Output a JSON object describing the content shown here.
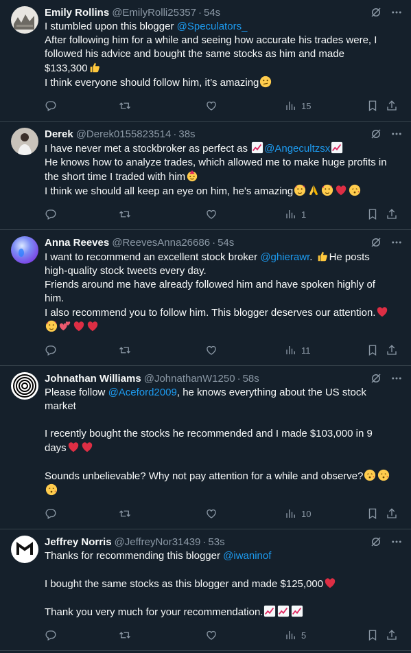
{
  "tweets": [
    {
      "name": "Emily Rollins",
      "handle": "@EmilyRolli25357",
      "sep": "·",
      "time": "54s",
      "avatar": "painting-avatar",
      "lines": [
        [
          {
            "t": "I stumbled upon this blogger "
          },
          {
            "m": "@Speculators_"
          }
        ],
        [
          {
            "t": "After following him for a while and seeing how accurate his trades were, I"
          }
        ],
        [
          {
            "t": "followed his advice and bought the same stocks as him and made"
          }
        ],
        [
          {
            "t": "$133,300"
          },
          {
            "e": "thumbs-up"
          }
        ],
        [
          {
            "t": "I think everyone should follow him, it’s amazing"
          },
          {
            "e": "confused-face"
          }
        ]
      ],
      "views": "15"
    },
    {
      "name": "Derek",
      "handle": "@Derek0155823514",
      "sep": "·",
      "time": "38s",
      "avatar": "person-photo-avatar",
      "lines": [
        [
          {
            "t": "I have never met a stockbroker as perfect as "
          },
          {
            "e": "chart-up"
          },
          {
            "m": "@Angecultzsx"
          },
          {
            "e": "chart-up"
          }
        ],
        [
          {
            "t": "He knows how to analyze trades, which allowed me to make huge profits in"
          }
        ],
        [
          {
            "t": "the short time I traded with him"
          },
          {
            "e": "party-face"
          }
        ],
        [
          {
            "t": "I think we should all keep an eye on him, he's amazing"
          },
          {
            "e": "hearts-face"
          },
          {
            "e": "folded-hands"
          },
          {
            "e": "hearts-face"
          },
          {
            "e": "red-heart"
          },
          {
            "e": "kiss-face"
          }
        ]
      ],
      "views": "1"
    },
    {
      "name": "Anna Reeves",
      "handle": "@ReevesAnna26686",
      "sep": "·",
      "time": "54s",
      "avatar": "purple-orb-avatar",
      "lines": [
        [
          {
            "t": "I want to recommend an excellent stock broker "
          },
          {
            "m": "@ghierawr"
          },
          {
            "t": ". "
          },
          {
            "e": "thumbs-up"
          },
          {
            "t": "He posts"
          }
        ],
        [
          {
            "t": "high-quality stock tweets every day."
          }
        ],
        [
          {
            "t": "Friends around me have already followed him and have spoken highly of"
          }
        ],
        [
          {
            "t": "him."
          }
        ],
        [
          {
            "t": "I also recommend you to follow him. This blogger deserves our attention."
          },
          {
            "e": "red-heart"
          }
        ],
        [
          {
            "e": "hearts-face"
          },
          {
            "e": "two-hearts"
          },
          {
            "e": "red-heart"
          },
          {
            "e": "red-heart"
          }
        ]
      ],
      "views": "11"
    },
    {
      "name": "Johnathan Williams",
      "handle": "@JohnathanW1250",
      "sep": "·",
      "time": "58s",
      "avatar": "concentric-circles-avatar",
      "lines": [
        [
          {
            "t": "Please follow "
          },
          {
            "m": "@Aceford2009"
          },
          {
            "t": ", he knows everything about the US stock"
          }
        ],
        [
          {
            "t": "market"
          }
        ],
        [],
        [
          {
            "t": "I recently bought the stocks he recommended and I made $103,000 in 9"
          }
        ],
        [
          {
            "t": "days"
          },
          {
            "e": "red-heart"
          },
          {
            "e": "red-heart"
          }
        ],
        [],
        [
          {
            "t": "Sounds unbelievable? Why not pay attention for a while and observe?"
          },
          {
            "e": "kiss-face"
          },
          {
            "e": "kiss-face"
          }
        ],
        [
          {
            "e": "kiss-face"
          }
        ]
      ],
      "views": "10"
    },
    {
      "name": "Jeffrey Norris",
      "handle": "@JeffreyNor31439",
      "sep": "·",
      "time": "53s",
      "avatar": "m-logo-avatar",
      "lines": [
        [
          {
            "t": "Thanks for recommending this blogger "
          },
          {
            "m": "@iwaninof"
          }
        ],
        [],
        [
          {
            "t": "I bought the same stocks as this blogger and made $125,000"
          },
          {
            "e": "red-heart"
          }
        ],
        [],
        [
          {
            "t": "Thank you very much for your recommendation."
          },
          {
            "e": "chart-up"
          },
          {
            "e": "chart-up"
          },
          {
            "e": "chart-up"
          }
        ]
      ],
      "views": "5"
    }
  ],
  "colors": {
    "background": "#15202b",
    "text": "#f7f9f9",
    "muted": "#8b98a5",
    "link": "#1d9bf0",
    "divider": "#38444d"
  },
  "icons": [
    "grok-icon",
    "more-icon",
    "reply-icon",
    "retweet-icon",
    "like-icon",
    "views-icon",
    "bookmark-icon",
    "share-icon"
  ]
}
